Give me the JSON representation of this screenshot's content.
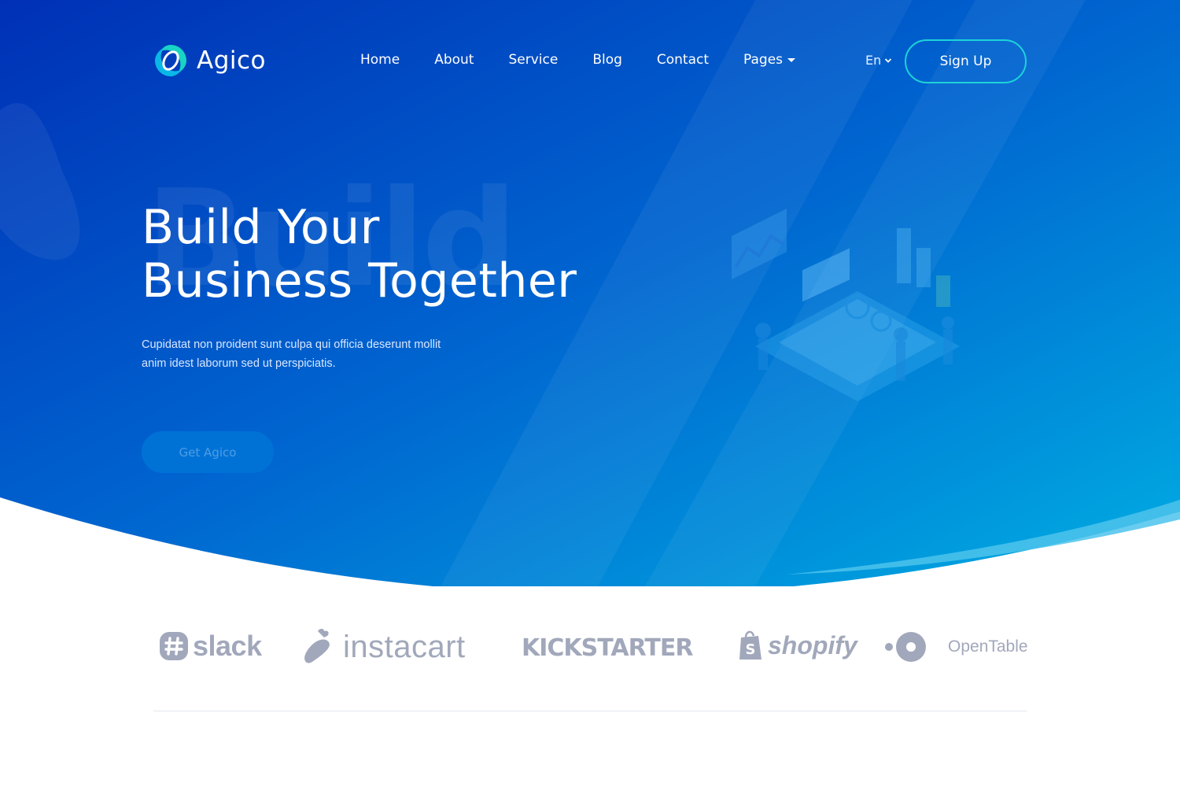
{
  "brand": {
    "name": "Agico"
  },
  "nav": {
    "items": [
      {
        "label": "Home"
      },
      {
        "label": "About"
      },
      {
        "label": "Service"
      },
      {
        "label": "Blog"
      },
      {
        "label": "Contact"
      },
      {
        "label": "Pages"
      }
    ],
    "language": "En",
    "signup_label": "Sign Up"
  },
  "hero": {
    "ghost_word": "Build",
    "title_line1": "Build Your",
    "title_line2": "Business Together",
    "description_line1": "Cupidatat non proident sunt culpa qui officia deserunt mollit",
    "description_line2": "anim idest laborum sed ut perspiciatis.",
    "cta_label": "Get Agico"
  },
  "partners": [
    {
      "name": "slack"
    },
    {
      "name": "instacart"
    },
    {
      "name": "KICKSTARTER"
    },
    {
      "name": "shopify"
    },
    {
      "name": "OpenTable"
    }
  ],
  "colors": {
    "hero_gradient_start": "#0033b8",
    "hero_gradient_end": "#00aee3",
    "accent_teal": "#1dd3d8",
    "logo_gray": "#a2a8bb"
  }
}
